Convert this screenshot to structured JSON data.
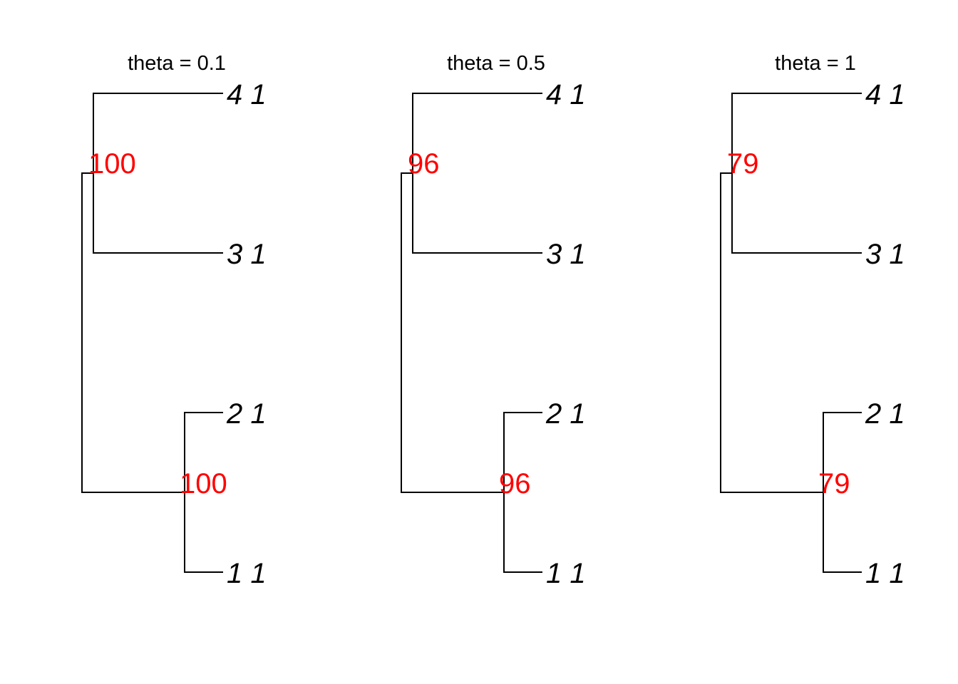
{
  "colors": {
    "branch": "#000000",
    "tip_label": "#000000",
    "support_label": "#ff0000",
    "background": "#ffffff"
  },
  "panels": [
    {
      "title": "theta = 0.1",
      "tips": [
        "4 1",
        "3 1",
        "2 1",
        "1 1"
      ],
      "supports": [
        "100",
        "100"
      ]
    },
    {
      "title": "theta = 0.5",
      "tips": [
        "4 1",
        "3 1",
        "2 1",
        "1 1"
      ],
      "supports": [
        "96",
        "96"
      ]
    },
    {
      "title": "theta = 1",
      "tips": [
        "4 1",
        "3 1",
        "2 1",
        "1 1"
      ],
      "supports": [
        "79",
        "79"
      ]
    }
  ]
}
